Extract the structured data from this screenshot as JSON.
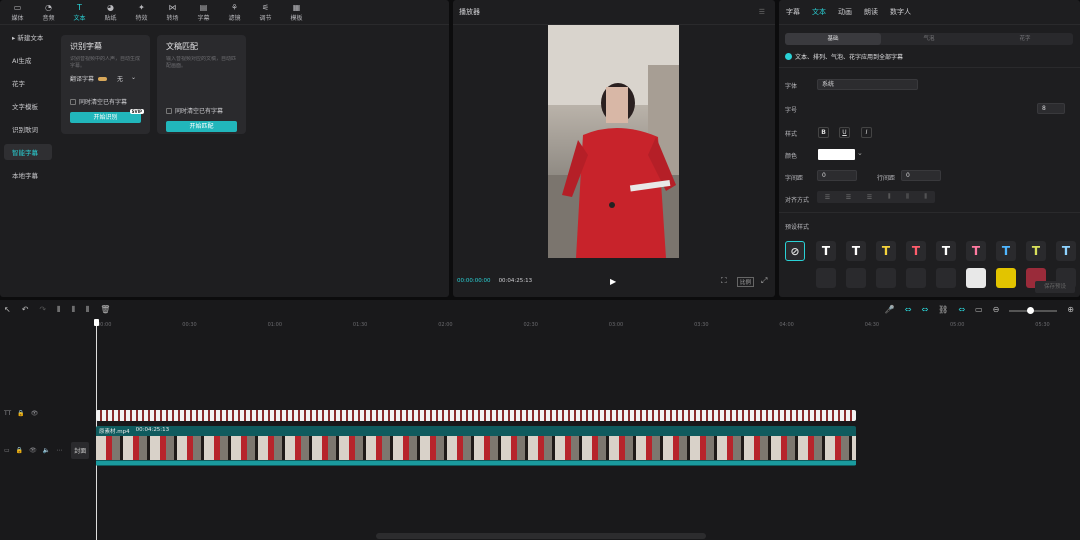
{
  "toolbar": {
    "items": [
      {
        "label": "媒体",
        "icon": "media-icon"
      },
      {
        "label": "音频",
        "icon": "audio-icon"
      },
      {
        "label": "文本",
        "icon": "text-icon",
        "active": true
      },
      {
        "label": "贴纸",
        "icon": "sticker-icon"
      },
      {
        "label": "特效",
        "icon": "effects-icon"
      },
      {
        "label": "转场",
        "icon": "transition-icon"
      },
      {
        "label": "字幕",
        "icon": "caption-icon"
      },
      {
        "label": "滤镜",
        "icon": "filter-icon"
      },
      {
        "label": "调节",
        "icon": "adjust-icon"
      },
      {
        "label": "模板",
        "icon": "template-icon"
      }
    ]
  },
  "sidebar": {
    "items": [
      {
        "label": "▸ 新建文本"
      },
      {
        "label": "AI生成"
      },
      {
        "label": "花字"
      },
      {
        "label": "文字模板"
      },
      {
        "label": "识别歌词"
      },
      {
        "label": "智能字幕",
        "active": true
      },
      {
        "label": "本地字幕"
      }
    ]
  },
  "cards": {
    "recognize": {
      "title": "识别字幕",
      "desc": "识别音视频中的人声，自动生成字幕。",
      "translate_label": "翻译字幕",
      "translate_value": "无",
      "clear_label": "同时清空已有字幕",
      "button": "开始识别",
      "badge": "SVIP"
    },
    "match": {
      "title": "文稿匹配",
      "desc": "输入音视频对应的文稿，自动匹配画面。",
      "clear_label": "同时清空已有字幕",
      "button": "开始匹配"
    }
  },
  "player": {
    "title": "播放器",
    "current_time": "00:00:00:00",
    "total_time": "00:04:25:13",
    "ratio_label": "比例"
  },
  "inspector": {
    "tabs": [
      "字幕",
      "文本",
      "动画",
      "朗读",
      "数字人"
    ],
    "active_tab": "文本",
    "subtabs": [
      "基础",
      "气泡",
      "花字"
    ],
    "active_subtab": "基础",
    "apply_all": "文本、排列、气泡、花字应用到全部字幕",
    "font_label": "字体",
    "font_value": "系统",
    "size_label": "字号",
    "size_value": "8",
    "style_label": "样式",
    "style_buttons": [
      "B",
      "U",
      "I"
    ],
    "color_label": "颜色",
    "color_value": "#ffffff",
    "char_spacing_label": "字间距",
    "char_spacing_value": "0",
    "line_spacing_label": "行间距",
    "line_spacing_value": "0",
    "align_label": "对齐方式",
    "presets_label": "预设样式",
    "preset_colors": [
      "#ffffff",
      "#ffffff",
      "#f5d33b",
      "#ff5d6c",
      "#ffffff",
      "#ff7aa1",
      "#4fb6ff",
      "#d8e05a",
      "#8fd3ff"
    ],
    "save_preset": "保存预设"
  },
  "timeline": {
    "ruler": [
      "00:00",
      "00:30",
      "01:00",
      "01:30",
      "02:00",
      "02:30",
      "03:00",
      "03:30",
      "04:00",
      "04:30",
      "05:00",
      "05:30"
    ],
    "clip_name": "原素材.mp4",
    "clip_duration": "00:04:25:13",
    "cover_label": "封面"
  }
}
